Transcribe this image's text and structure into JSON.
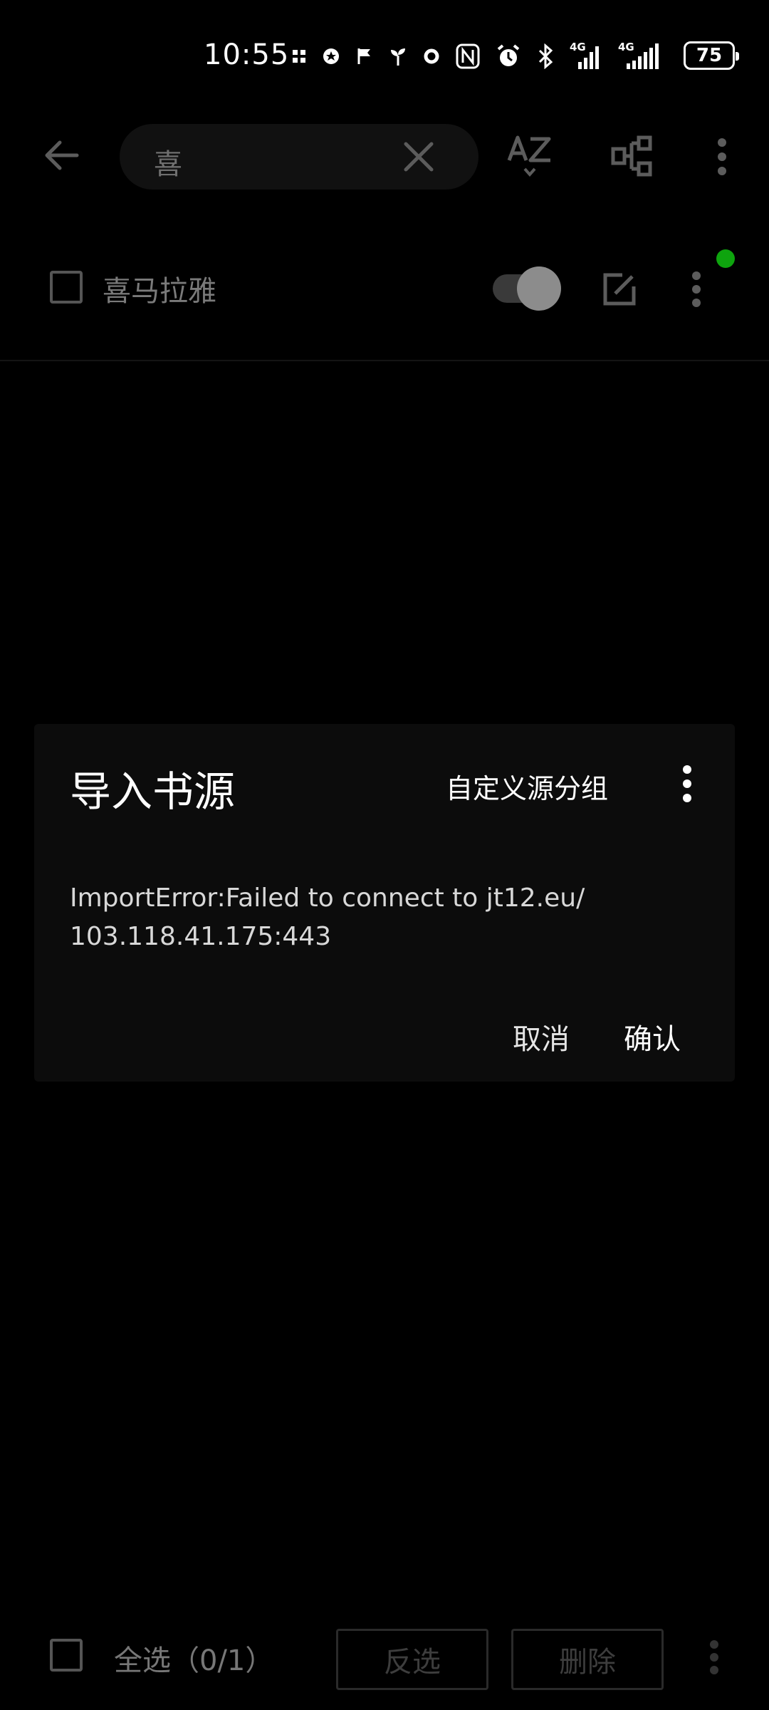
{
  "status_bar": {
    "time": "10:55",
    "battery": "75",
    "network_1": "4G",
    "network_2": "4G"
  },
  "toolbar": {
    "search_query": "喜"
  },
  "list": {
    "items": [
      {
        "label": "喜马拉雅",
        "enabled": true
      }
    ]
  },
  "dialog": {
    "title": "导入书源",
    "custom_group": "自定义源分组",
    "message": "ImportError:Failed to connect to jt12.eu/\n103.118.41.175:443",
    "cancel": "取消",
    "confirm": "确认"
  },
  "bottom_bar": {
    "select_all": "全选（0/1）",
    "invert": "反选",
    "delete": "删除"
  },
  "colors": {
    "accent_green": "#0ea40e",
    "background": "#000000",
    "dialog_bg": "#0c0c0c"
  }
}
